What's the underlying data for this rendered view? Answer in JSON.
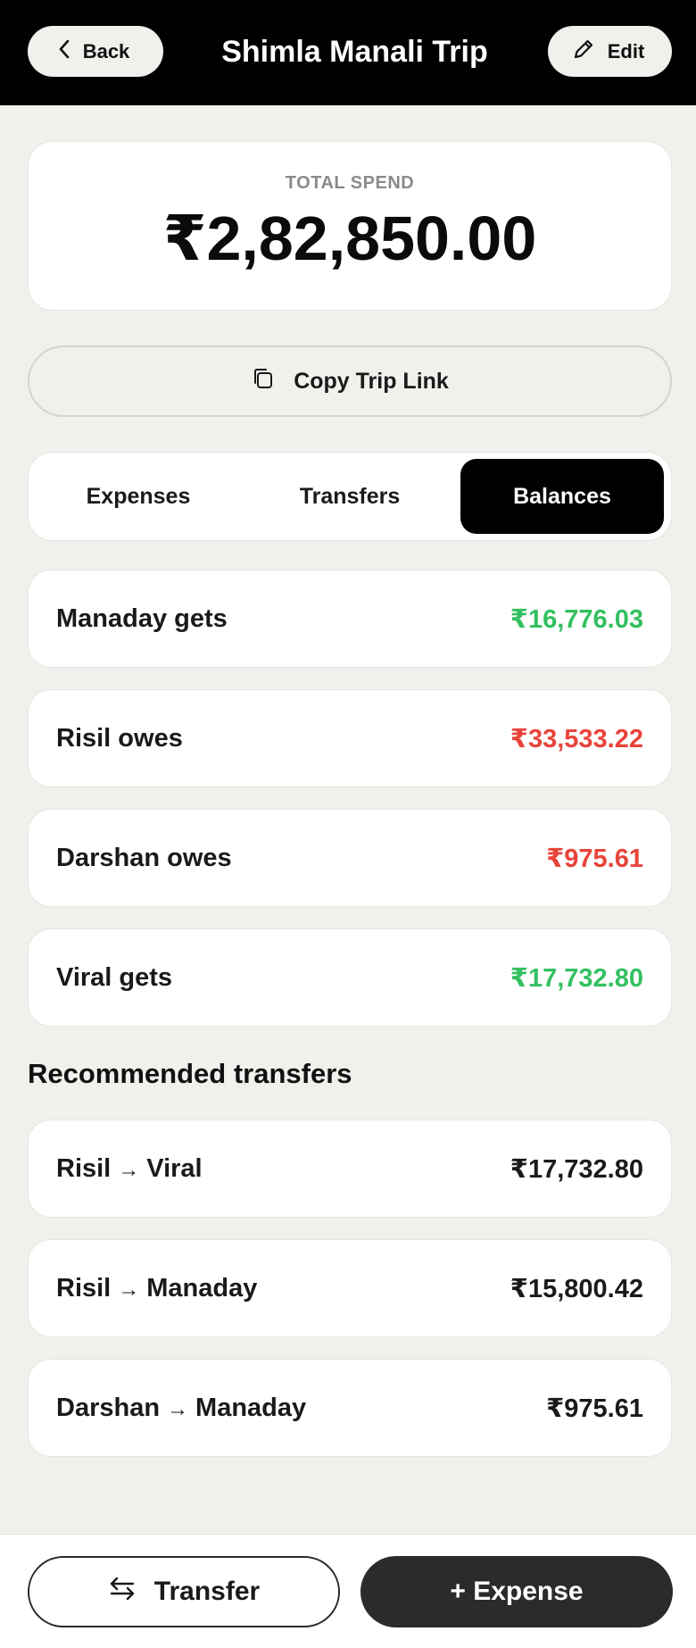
{
  "header": {
    "back_label": "Back",
    "title": "Shimla Manali Trip",
    "edit_label": "Edit"
  },
  "summary": {
    "label": "TOTAL SPEND",
    "value": "₹2,82,850.00"
  },
  "copy_link_label": "Copy Trip Link",
  "tabs": [
    {
      "label": "Expenses",
      "active": false
    },
    {
      "label": "Transfers",
      "active": false
    },
    {
      "label": "Balances",
      "active": true
    }
  ],
  "balances": [
    {
      "label": "Manaday gets",
      "amount": "₹16,776.03",
      "status": "positive"
    },
    {
      "label": "Risil owes",
      "amount": "₹33,533.22",
      "status": "negative"
    },
    {
      "label": "Darshan owes",
      "amount": "₹975.61",
      "status": "negative"
    },
    {
      "label": "Viral gets",
      "amount": "₹17,732.80",
      "status": "positive"
    }
  ],
  "recommended": {
    "title": "Recommended transfers",
    "arrow": "→",
    "items": [
      {
        "from": "Risil",
        "to": "Viral",
        "amount": "₹17,732.80"
      },
      {
        "from": "Risil",
        "to": "Manaday",
        "amount": "₹15,800.42"
      },
      {
        "from": "Darshan",
        "to": "Manaday",
        "amount": "₹975.61"
      }
    ]
  },
  "bottom": {
    "transfer_label": "Transfer",
    "expense_label": "+ Expense"
  },
  "colors": {
    "positive": "#33c060",
    "negative": "#e8443a",
    "header_bg": "#000000",
    "page_bg": "#f1f0ec"
  },
  "icons": {
    "back": "chevron-left-icon",
    "edit": "pencil-icon",
    "copy": "copy-icon",
    "transfer": "swap-arrows-icon"
  }
}
